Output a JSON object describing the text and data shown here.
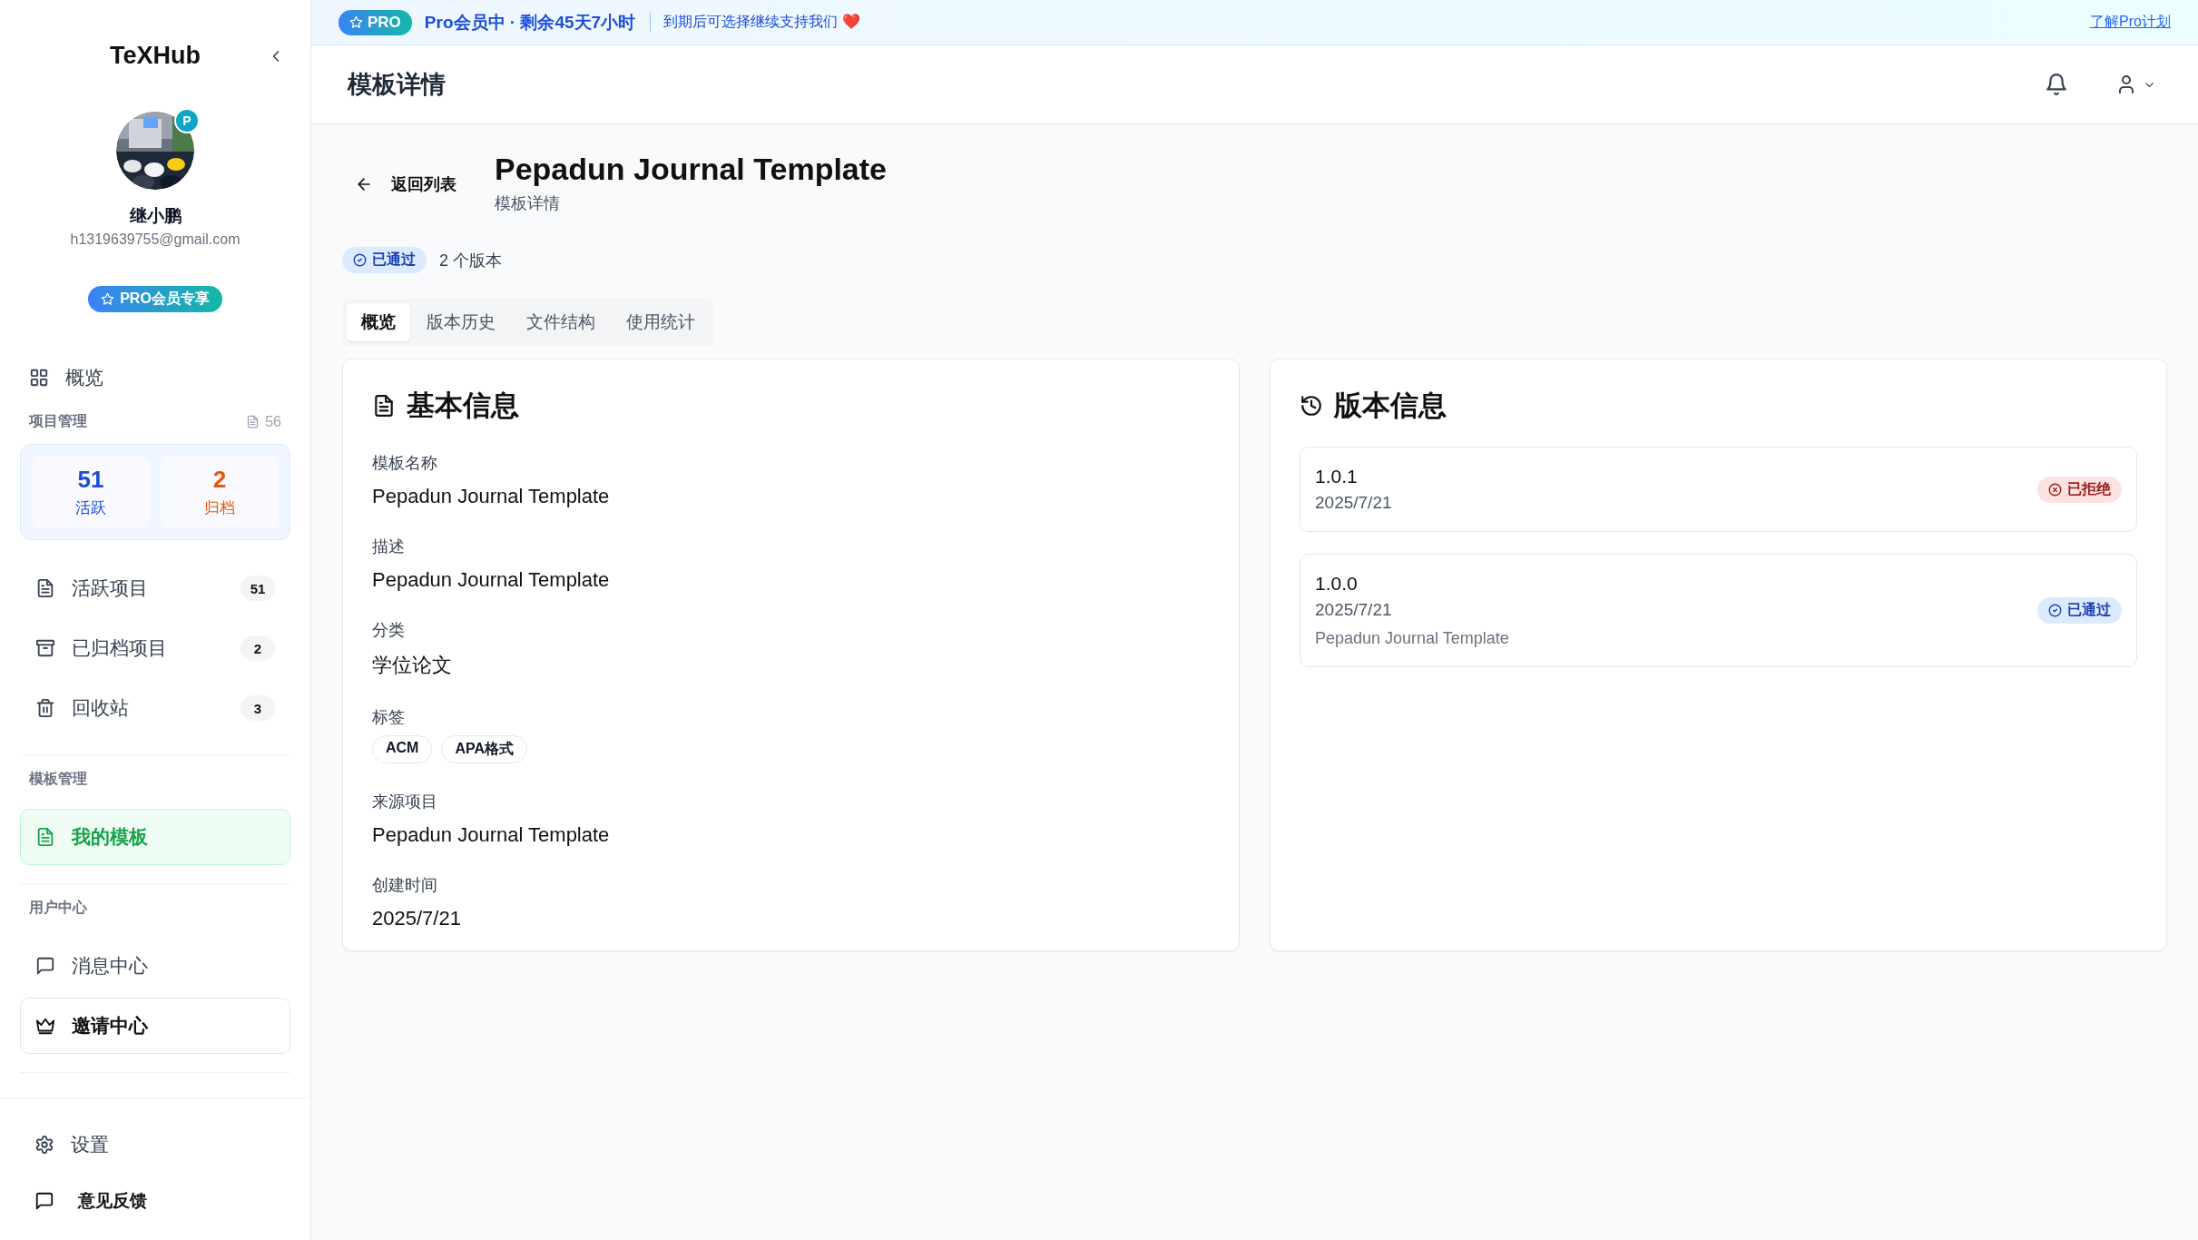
{
  "banner": {
    "badge": "PRO",
    "status": "Pro会员中 · 剩余45天7小时",
    "note": "到期后可选择继续支持我们 ❤️",
    "link": "了解Pro计划"
  },
  "sidebar": {
    "logo": "TeXHub",
    "user": {
      "avatar_badge": "P",
      "name": "继小鹏",
      "email": "h1319639755@gmail.com"
    },
    "pro_badge": "PRO会员专享",
    "overview": "概览",
    "sections": [
      {
        "title": "项目管理",
        "count": "56",
        "stats": [
          {
            "value": "51",
            "label": "活跃",
            "kind": "active"
          },
          {
            "value": "2",
            "label": "归档",
            "kind": "archived"
          }
        ],
        "items": [
          {
            "label": "活跃项目",
            "kind": "document",
            "count": "51",
            "selected": false,
            "hovered": false
          },
          {
            "label": "已归档项目",
            "kind": "archive",
            "count": "2",
            "selected": false,
            "hovered": false
          },
          {
            "label": "回收站",
            "kind": "trash",
            "count": "3",
            "selected": false,
            "hovered": false
          }
        ]
      },
      {
        "title": "模板管理",
        "items": [
          {
            "label": "我的模板",
            "kind": "document",
            "selected": true,
            "hovered": false
          }
        ]
      },
      {
        "title": "用户中心",
        "items": [
          {
            "label": "消息中心",
            "kind": "message",
            "selected": false,
            "hovered": false
          },
          {
            "label": "邀请中心",
            "kind": "invite",
            "selected": false,
            "hovered": true
          }
        ]
      }
    ],
    "footer": [
      {
        "label": "设置",
        "kind": "settings"
      },
      {
        "label": "意见反馈",
        "kind": "message"
      }
    ]
  },
  "header": {
    "title": "模板详情"
  },
  "template": {
    "back": "返回列表",
    "title": "Pepadun Journal Template",
    "subtitle": "模板详情",
    "status": {
      "label": "已通过",
      "kind": "approved"
    },
    "version_count": "2 个版本"
  },
  "tabs": [
    {
      "label": "概览",
      "selected": true
    },
    {
      "label": "版本历史",
      "selected": false
    },
    {
      "label": "文件结构",
      "selected": false
    },
    {
      "label": "使用统计",
      "selected": false
    }
  ],
  "basic_info": {
    "title": "基本信息",
    "fields": [
      {
        "label": "模板名称",
        "value": "Pepadun Journal Template"
      },
      {
        "label": "描述",
        "value": "Pepadun Journal Template"
      },
      {
        "label": "分类",
        "value": "学位论文"
      },
      {
        "label": "标签",
        "tags": [
          "ACM",
          "APA格式"
        ]
      },
      {
        "label": "来源项目",
        "value": "Pepadun Journal Template"
      },
      {
        "label": "创建时间",
        "value": "2025/7/21"
      }
    ]
  },
  "version_info": {
    "title": "版本信息",
    "versions": [
      {
        "version": "1.0.1",
        "date": "2025/7/21",
        "status": {
          "label": "已拒绝",
          "kind": "rejected"
        }
      },
      {
        "version": "1.0.0",
        "date": "2025/7/21",
        "description": "Pepadun Journal Template",
        "status": {
          "label": "已通过",
          "kind": "approved"
        }
      }
    ]
  }
}
